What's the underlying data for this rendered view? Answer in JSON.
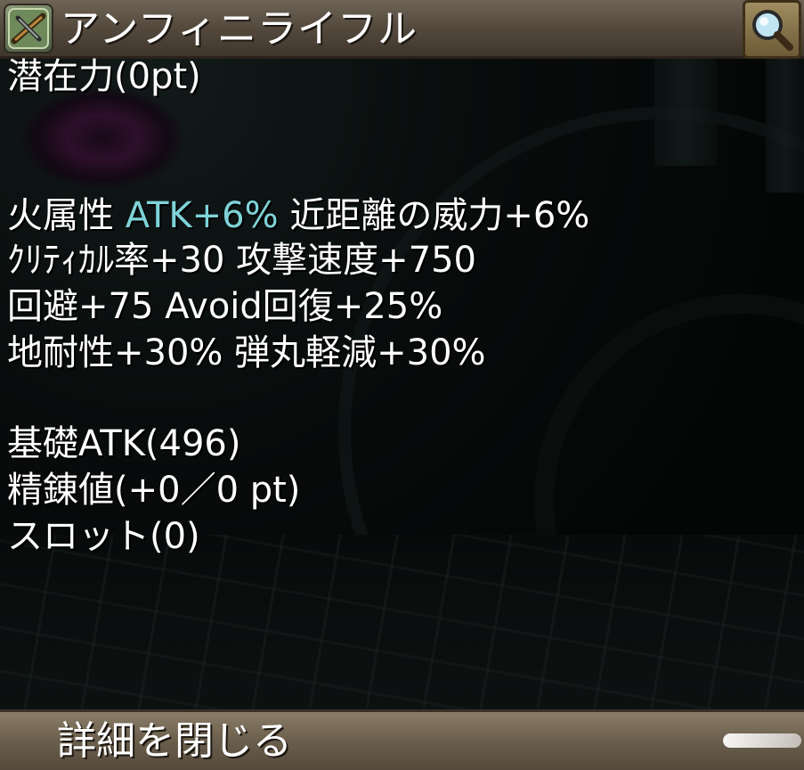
{
  "header": {
    "title": "アンフィニライフル",
    "weapon_icon": "rifle-icon",
    "search_icon": "magnifier-icon"
  },
  "stats": {
    "potential": "潜在力(0pt)",
    "line1_prefix": "火属性 ",
    "line1_accent": "ATK+6%",
    "line1_suffix": " 近距離の威力+6%",
    "line2": "ｸﾘﾃｨｶﾙ率+30 攻撃速度+750",
    "line3": "回避+75 Avoid回復+25%",
    "line4": "地耐性+30% 弾丸軽減+30%",
    "base_atk": "基礎ATK(496)",
    "refine": "精錬値(+0／0 pt)",
    "slots": "スロット(0)"
  },
  "footer": {
    "close_label": "詳細を閉じる"
  },
  "colors": {
    "accent": "#7fd3d8",
    "text": "#ffffff",
    "bar": "#6e6456"
  }
}
